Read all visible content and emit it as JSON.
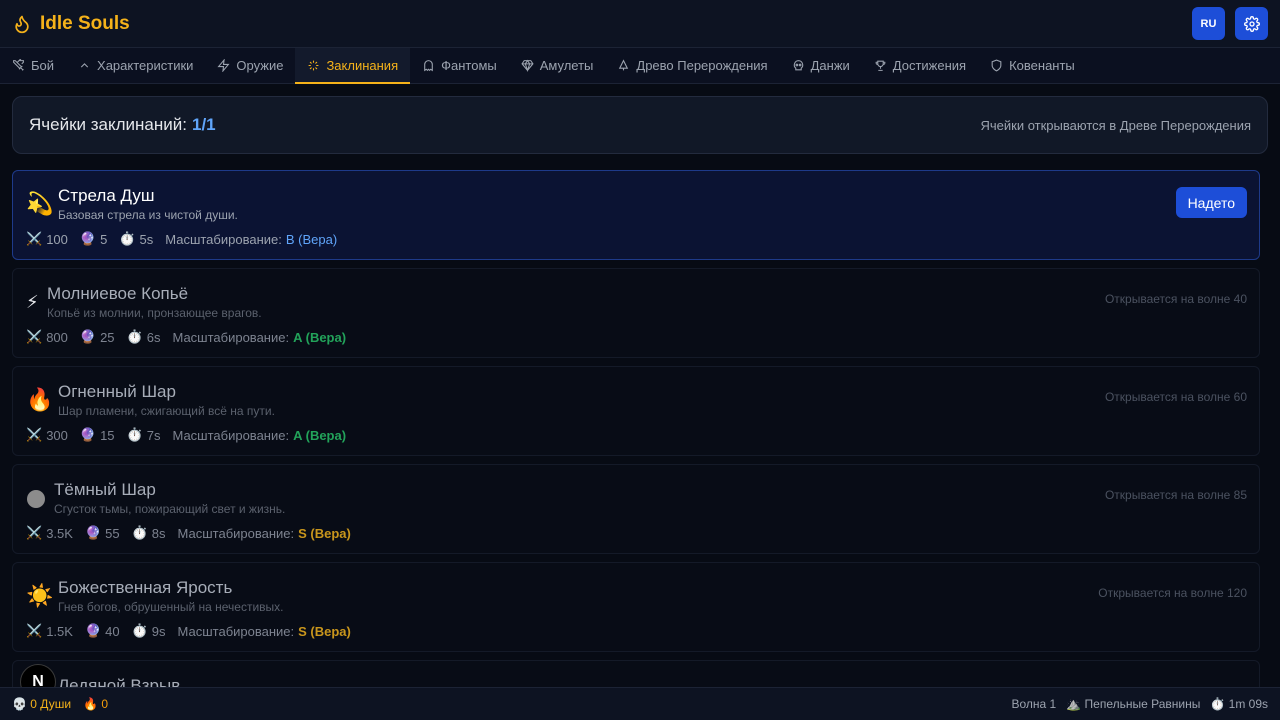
{
  "app": {
    "title": "Idle Souls"
  },
  "header": {
    "lang_label": "RU",
    "settings_icon": "gear-icon"
  },
  "tabs": [
    {
      "label": "Бой",
      "icon": "swords-icon"
    },
    {
      "label": "Характеристики",
      "icon": "chevron-up-icon"
    },
    {
      "label": "Оружие",
      "icon": "bolt-icon"
    },
    {
      "label": "Заклинания",
      "icon": "sparkles-icon",
      "active": true
    },
    {
      "label": "Фантомы",
      "icon": "ghost-icon"
    },
    {
      "label": "Амулеты",
      "icon": "gem-icon"
    },
    {
      "label": "Древо Перерождения",
      "icon": "tree-icon"
    },
    {
      "label": "Данжи",
      "icon": "skull-icon"
    },
    {
      "label": "Достижения",
      "icon": "trophy-icon"
    },
    {
      "label": "Ковенанты",
      "icon": "shield-icon"
    }
  ],
  "slots": {
    "label": "Ячейки заклинаний:",
    "value": "1/1",
    "note": "Ячейки открываются в Древе Перерождения"
  },
  "scaling_label": "Масштабирование:",
  "spells": [
    {
      "icon": "💫",
      "name": "Стрела Душ",
      "desc": "Базовая стрела из чистой души.",
      "damage": "100",
      "mana": "5",
      "cooldown": "5s",
      "scaling": "B (Вера)",
      "state": "equipped",
      "action": "Надето"
    },
    {
      "icon": "⚡",
      "name": "Молниевое Копьё",
      "desc": "Копьё из молнии, пронзающее врагов.",
      "damage": "800",
      "mana": "25",
      "cooldown": "6s",
      "scaling": "A (Вера)",
      "state": "locked",
      "unlock": "Открывается на волне 40"
    },
    {
      "icon": "🔥",
      "name": "Огненный Шар",
      "desc": "Шар пламени, сжигающий всё на пути.",
      "damage": "300",
      "mana": "15",
      "cooldown": "7s",
      "scaling": "A (Вера)",
      "state": "locked",
      "unlock": "Открывается на волне 60"
    },
    {
      "icon": "dark-orb",
      "name": "Тёмный Шар",
      "desc": "Сгусток тьмы, пожирающий свет и жизнь.",
      "damage": "3.5K",
      "mana": "55",
      "cooldown": "8s",
      "scaling": "S (Вера)",
      "state": "locked",
      "unlock": "Открывается на волне 85"
    },
    {
      "icon": "☀️",
      "name": "Божественная Ярость",
      "desc": "Гнев богов, обрушенный на нечестивых.",
      "damage": "1.5K",
      "mana": "40",
      "cooldown": "9s",
      "scaling": "S (Вера)",
      "state": "locked",
      "unlock": "Открывается на волне 120"
    },
    {
      "icon": "",
      "name": "Ледяной Взрыв",
      "desc": "",
      "damage": "",
      "mana": "",
      "cooldown": "",
      "scaling": "",
      "state": "locked",
      "unlock": ""
    }
  ],
  "footer": {
    "souls": "0 Души",
    "embers": "0",
    "wave": "Волна 1",
    "location": "Пепельные Равнины",
    "time": "1m 09s"
  },
  "colors": {
    "accent": "#f5b21a",
    "primary": "#1d4ed8",
    "grade_b": "#60a5fa",
    "grade_a": "#22a35a",
    "grade_s": "#c9961c"
  }
}
